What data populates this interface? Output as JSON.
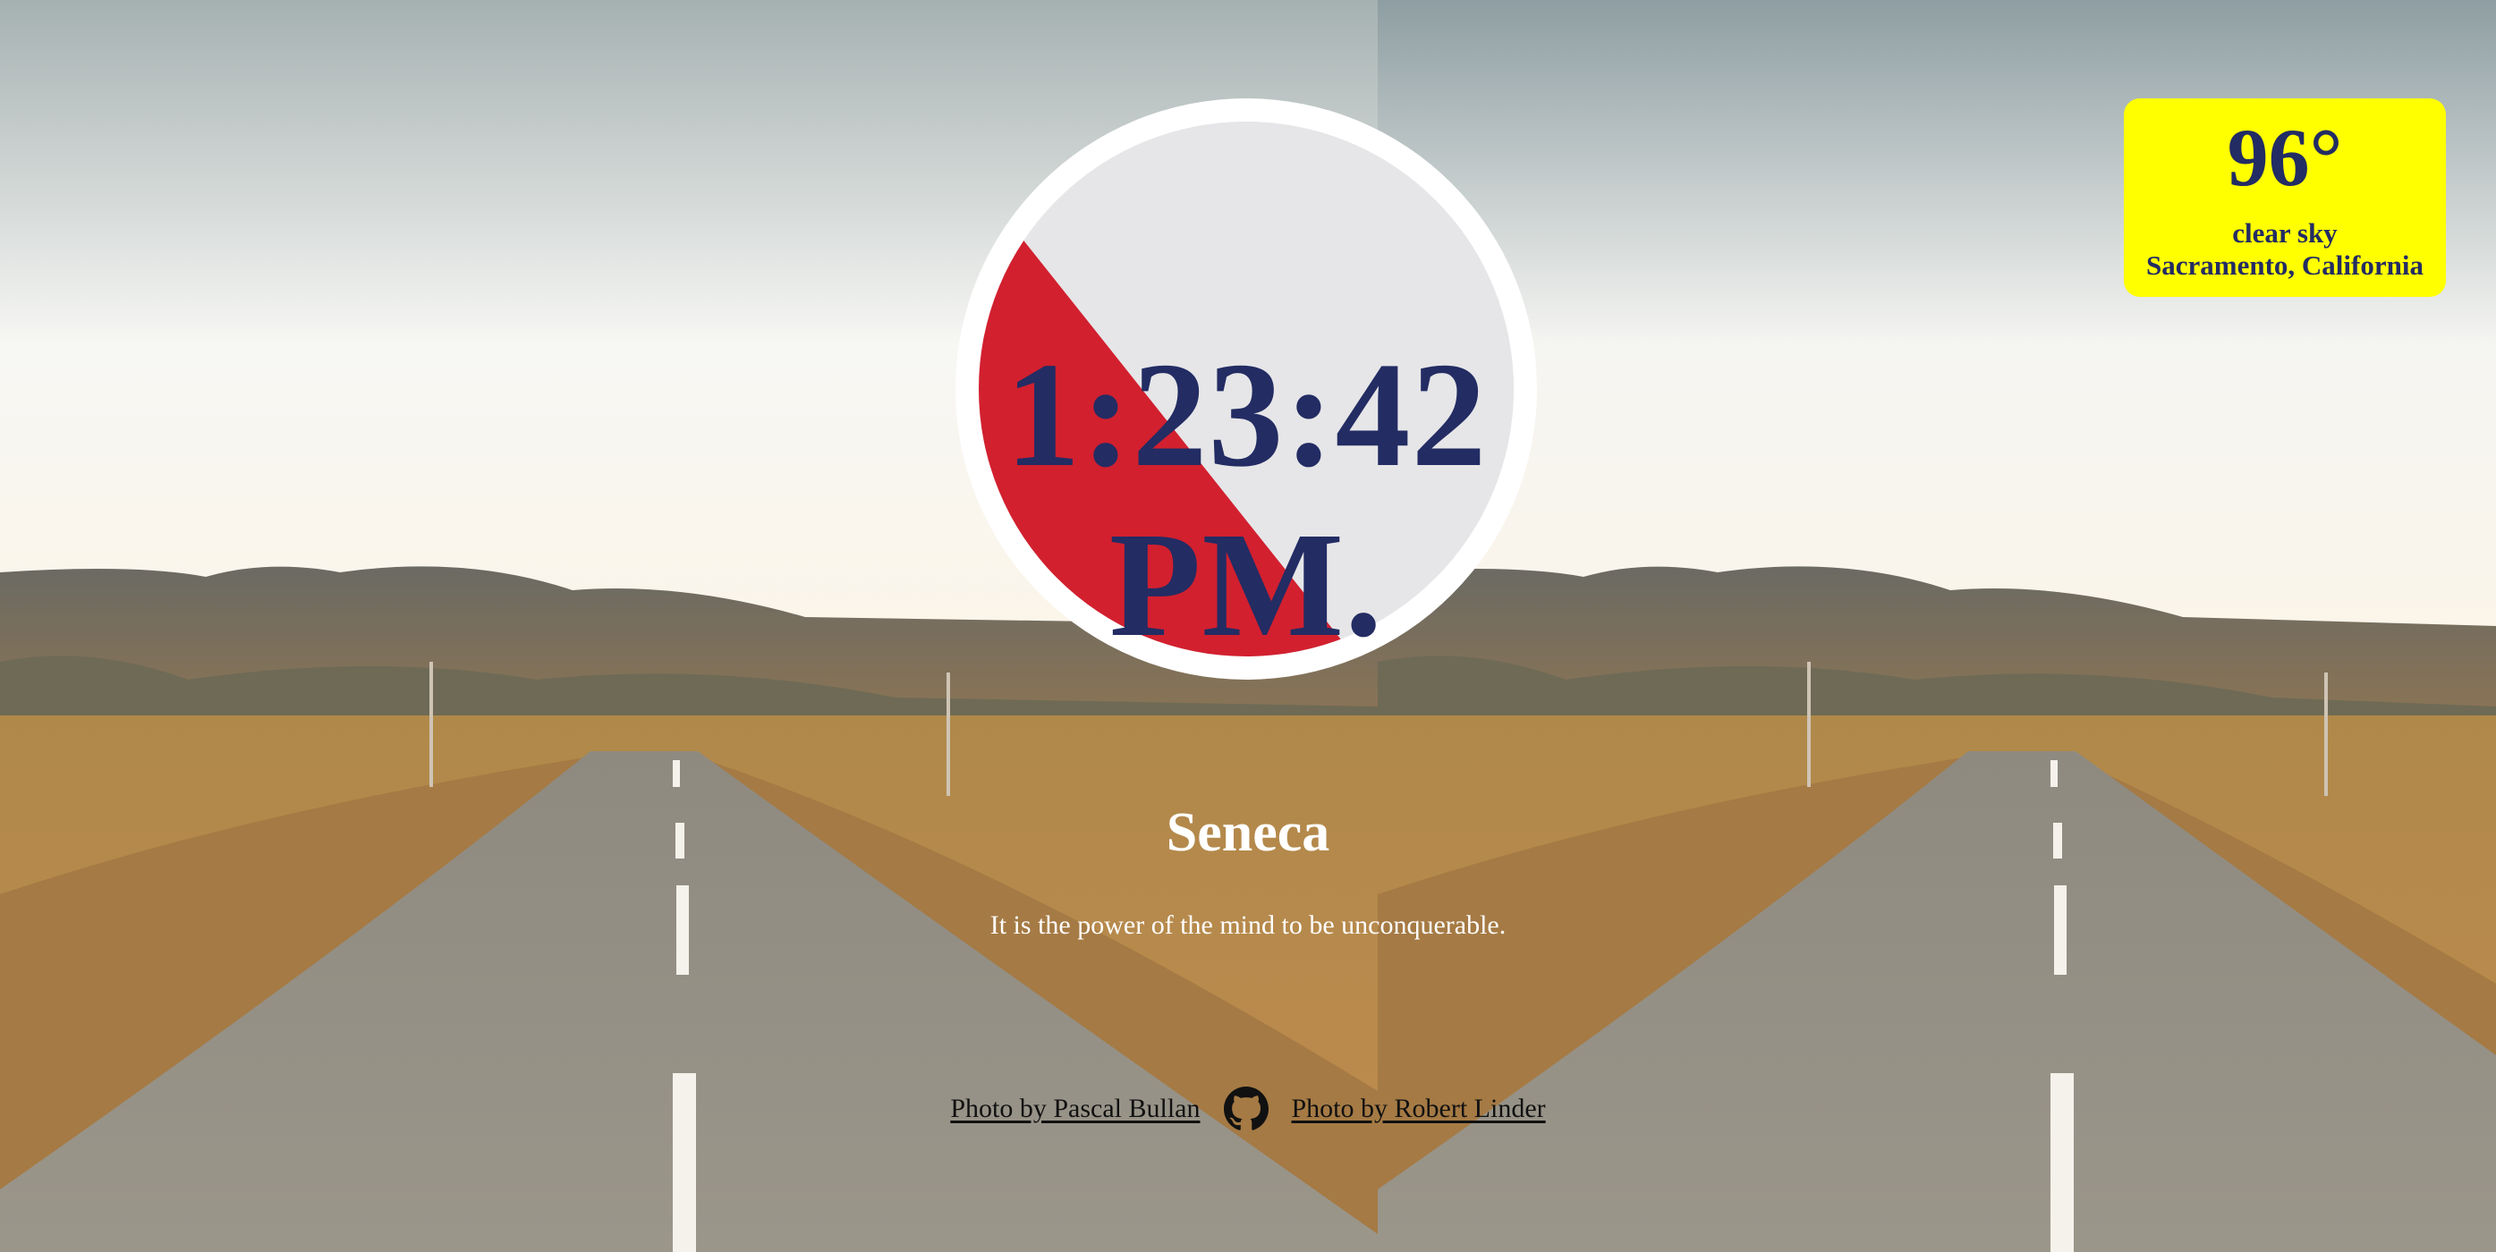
{
  "clock": {
    "time": "1:23:42",
    "ampm": "PM."
  },
  "weather": {
    "temperature": "96°",
    "description": "clear sky",
    "location": "Sacramento, California",
    "background_color": "#ffff00",
    "text_color": "#232c63"
  },
  "quote": {
    "author": "Seneca",
    "text": "It is the power of the mind to be unconquerable."
  },
  "footer": {
    "credit_left": "Photo by Pascal Bullan",
    "github_icon": "github-icon",
    "credit_right": "Photo by Robert Linder"
  },
  "colors": {
    "clock_text": "#232c63",
    "clock_ring": "#ffffff",
    "clock_stripe": "#d2202f",
    "weather_bg": "#ffff00"
  }
}
